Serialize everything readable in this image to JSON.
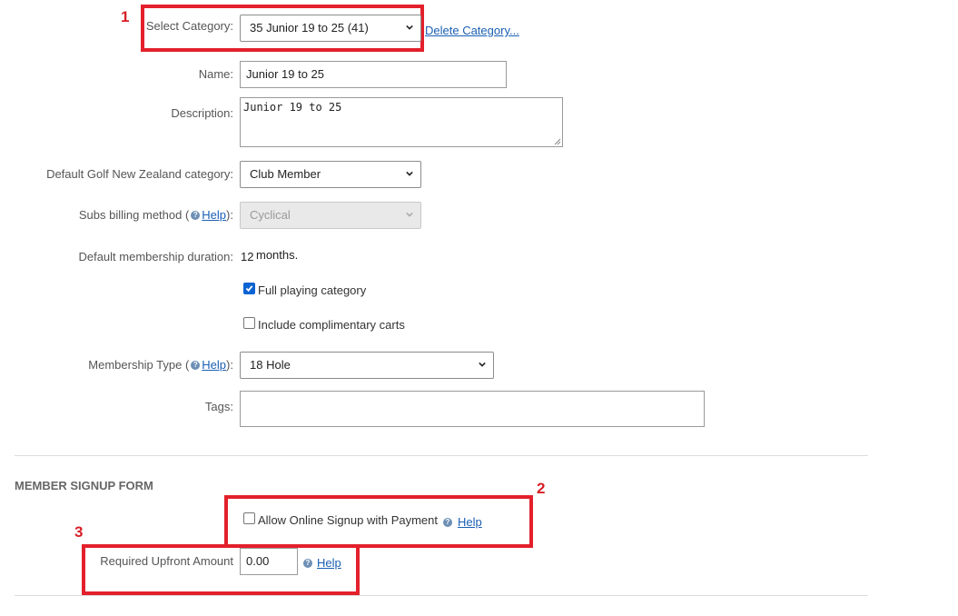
{
  "annotations": {
    "n1": "1",
    "n2": "2",
    "n3": "3"
  },
  "category": {
    "label": "Select Category:",
    "selected": "35 Junior 19 to 25 (41)",
    "delete_link": "Delete Category..."
  },
  "name": {
    "label": "Name:",
    "value": "Junior 19 to 25"
  },
  "description": {
    "label": "Description:",
    "value": "Junior 19 to 25"
  },
  "gnz": {
    "label": "Default Golf New Zealand category:",
    "selected": "Club Member"
  },
  "subs": {
    "label_pre": "Subs billing method (",
    "help": "Help",
    "label_post": "):",
    "selected": "Cyclical"
  },
  "duration": {
    "label": "Default membership duration:",
    "value": "12",
    "unit": "months."
  },
  "full_playing": {
    "label": "Full playing category",
    "checked": true
  },
  "carts": {
    "label": "Include complimentary carts",
    "checked": false
  },
  "membership_type": {
    "label_pre": "Membership Type (",
    "help": "Help",
    "label_post": "):",
    "selected": "18 Hole"
  },
  "tags": {
    "label": "Tags:",
    "value": ""
  },
  "signup": {
    "heading": "MEMBER SIGNUP FORM",
    "online_label": "Allow Online Signup with Payment",
    "online_checked": false,
    "help": "Help",
    "upfront_label": "Required Upfront Amount",
    "upfront_value": "0.00"
  },
  "colors": {
    "annotation_red": "#e3202b",
    "link": "#1a5fb4",
    "checkbox_blue": "#0b63d4"
  }
}
